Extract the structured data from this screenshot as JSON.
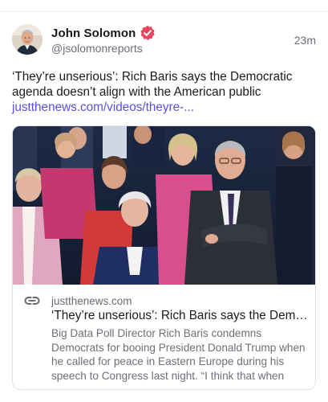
{
  "post": {
    "author_name": "John Solomon",
    "handle": "@jsolomonreports",
    "timestamp": "23m",
    "text": "‘They’re unserious’: Rich Baris says the Democratic agenda doesn’t align with the American public",
    "link_text": "justthenews.com/videos/theyre-..."
  },
  "link_card": {
    "domain": "justthenews.com",
    "title": "‘They’re unserious’: Rich Baris says the Democr...",
    "description": "Big Data Poll Director Rich Baris condemns Democrats for booing President Donald Trump when he called for peace in Eastern Europe during his speech to Congress last night. “I think that when you're doing that, you’re ..."
  },
  "icons": {
    "verified": "verified-badge-icon",
    "link": "link-icon"
  },
  "colors": {
    "accent_link": "#5b4fe0",
    "verified_badge": "#e8475f"
  }
}
